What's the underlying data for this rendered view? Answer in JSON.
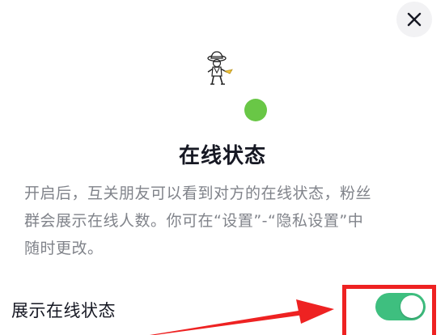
{
  "dialog": {
    "title": "在线状态",
    "description_lines": [
      "开启后，互关朋友可以看到对方的在线状态，粉丝",
      "群会展示在线人数。你可在“设置”-“隐私设置”中",
      "随时更改。"
    ],
    "close_icon": "close-icon",
    "online_indicator_color": "#69c746"
  },
  "setting": {
    "label": "展示在线状态",
    "toggle_on": true,
    "toggle_color": "#3ebf7f"
  },
  "annotation": {
    "highlight_color": "#ee2222",
    "arrow_color": "#ee2222"
  }
}
